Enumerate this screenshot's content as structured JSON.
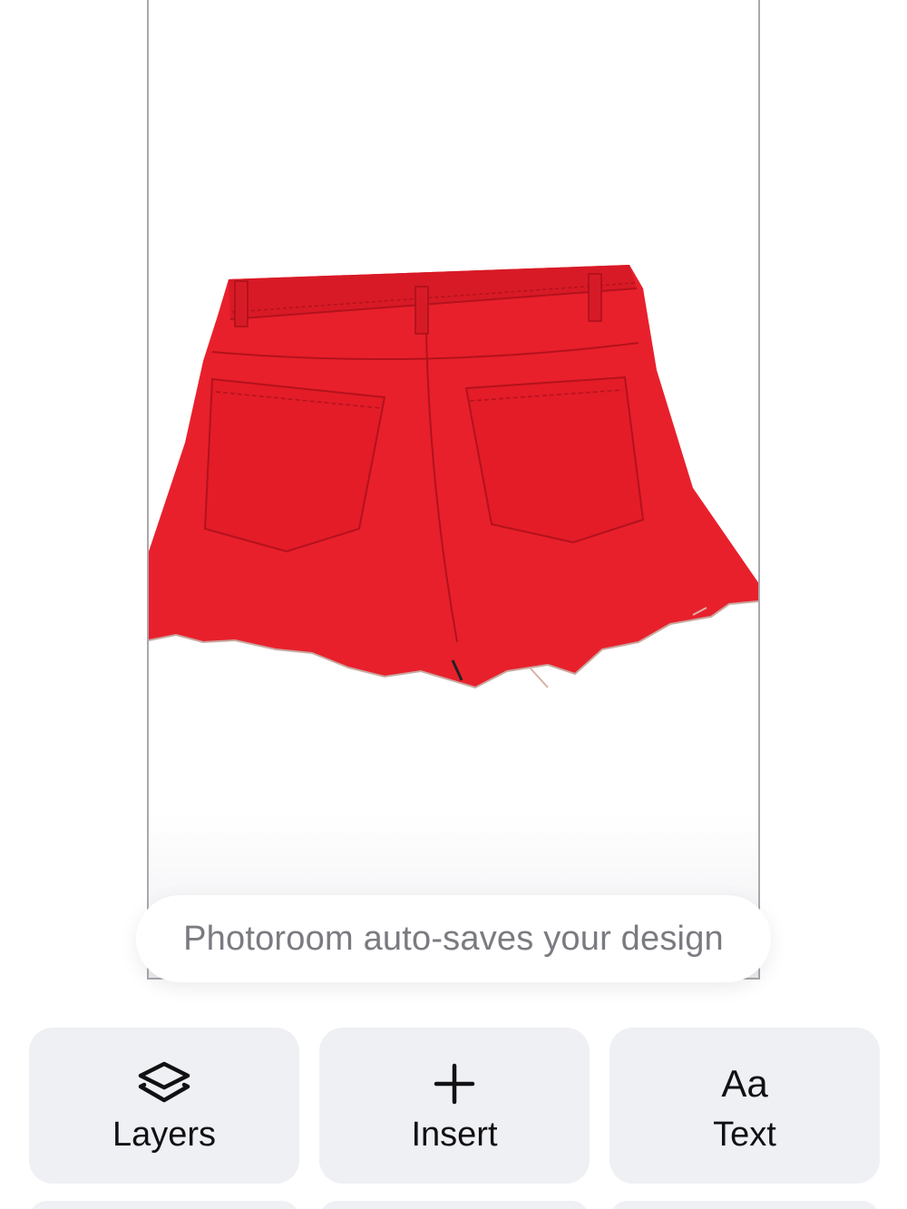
{
  "toast": {
    "message": "Photoroom auto-saves your design"
  },
  "toolbar": {
    "buttons": [
      {
        "label": "Layers",
        "icon": "layers-icon"
      },
      {
        "label": "Insert",
        "icon": "plus-icon"
      },
      {
        "label": "Text",
        "icon": "text-aa-icon",
        "glyph": "Aa"
      }
    ]
  },
  "colors": {
    "product": "#e8202c",
    "button_bg": "#eff0f3",
    "toast_text": "#7a7b80"
  }
}
